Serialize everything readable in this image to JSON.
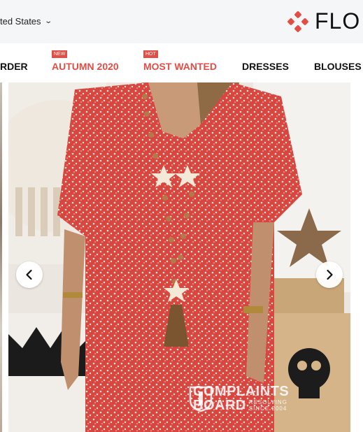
{
  "header": {
    "region_label": "ted States",
    "region_chevron_icon": "chevron-down-icon",
    "logo_text": "FLO",
    "logo_color": "#e24d45"
  },
  "nav": {
    "items": [
      {
        "label": "RDER",
        "badge": "",
        "highlight": false
      },
      {
        "label": "AUTUMN 2020",
        "badge": "NEW",
        "highlight": true
      },
      {
        "label": "MOST WANTED",
        "badge": "HOT",
        "highlight": true
      },
      {
        "label": "DRESSES",
        "badge": "",
        "highlight": false
      },
      {
        "label": "BLOUSES",
        "badge": "",
        "highlight": false
      }
    ],
    "accent_color": "#e24d45"
  },
  "gallery": {
    "prev_icon": "chevron-left-icon",
    "next_icon": "chevron-right-icon",
    "watermark": {
      "line1": "COMPLAINTS",
      "line2": "BOARD",
      "tag1": "RESOLVING",
      "tag2": "SINCE 2004"
    }
  }
}
